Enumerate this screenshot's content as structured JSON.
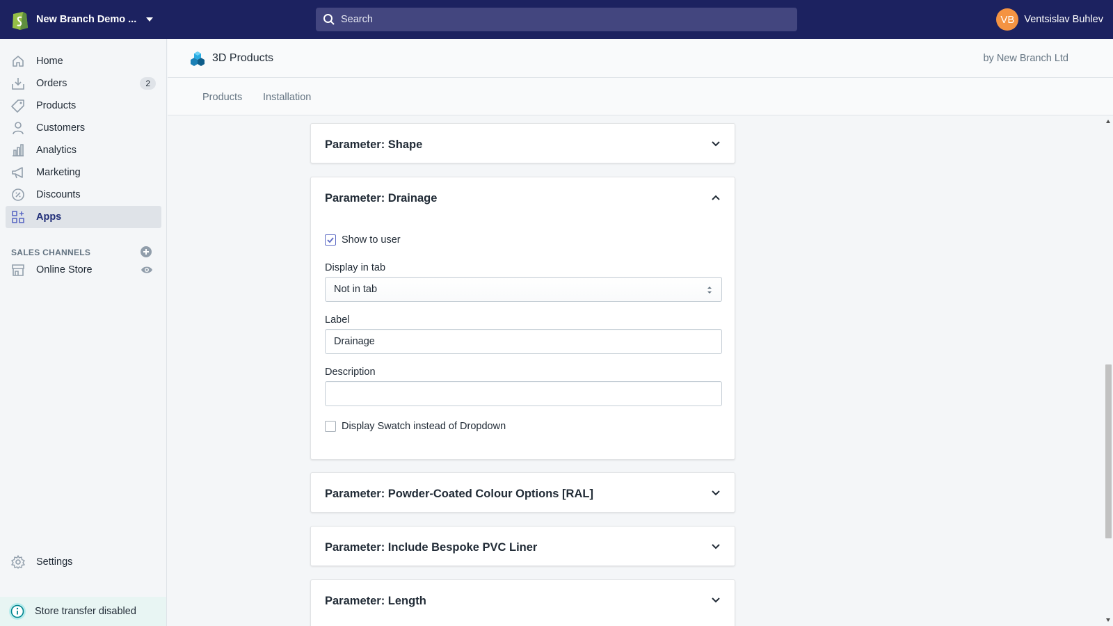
{
  "topbar": {
    "store_name": "New Branch Demo ...",
    "search_placeholder": "Search",
    "user_initials": "VB",
    "user_name": "Ventsislav Buhlev"
  },
  "sidebar": {
    "items": [
      {
        "label": "Home",
        "icon": "home-icon"
      },
      {
        "label": "Orders",
        "icon": "orders-icon",
        "badge": "2"
      },
      {
        "label": "Products",
        "icon": "tag-icon"
      },
      {
        "label": "Customers",
        "icon": "person-icon"
      },
      {
        "label": "Analytics",
        "icon": "bar-chart-icon"
      },
      {
        "label": "Marketing",
        "icon": "megaphone-icon"
      },
      {
        "label": "Discounts",
        "icon": "discount-icon"
      },
      {
        "label": "Apps",
        "icon": "apps-icon",
        "active": true
      }
    ],
    "sales_channels_heading": "SALES CHANNELS",
    "online_store": "Online Store",
    "settings": "Settings",
    "store_transfer": "Store transfer disabled"
  },
  "app_header": {
    "title": "3D Products",
    "by": "by New Branch Ltd",
    "tabs": [
      "Products",
      "Installation"
    ]
  },
  "cards": {
    "shape": {
      "title": "Parameter: Shape"
    },
    "drainage": {
      "title": "Parameter: Drainage",
      "show_to_user": "Show to user",
      "show_to_user_checked": true,
      "display_in_tab_label": "Display in tab",
      "display_in_tab_value": "Not in tab",
      "label_label": "Label",
      "label_value": "Drainage",
      "description_label": "Description",
      "description_value": "",
      "swatch_label": "Display Swatch instead of Dropdown",
      "swatch_checked": false
    },
    "powder": {
      "title": "Parameter: Powder-Coated Colour Options [RAL]"
    },
    "liner": {
      "title": "Parameter: Include Bespoke PVC Liner"
    },
    "length": {
      "title": "Parameter: Length"
    }
  },
  "colors": {
    "topbar": "#1c2260",
    "accent": "#5c6ac4",
    "active_nav": "#202e78",
    "avatar": "#f49342"
  }
}
